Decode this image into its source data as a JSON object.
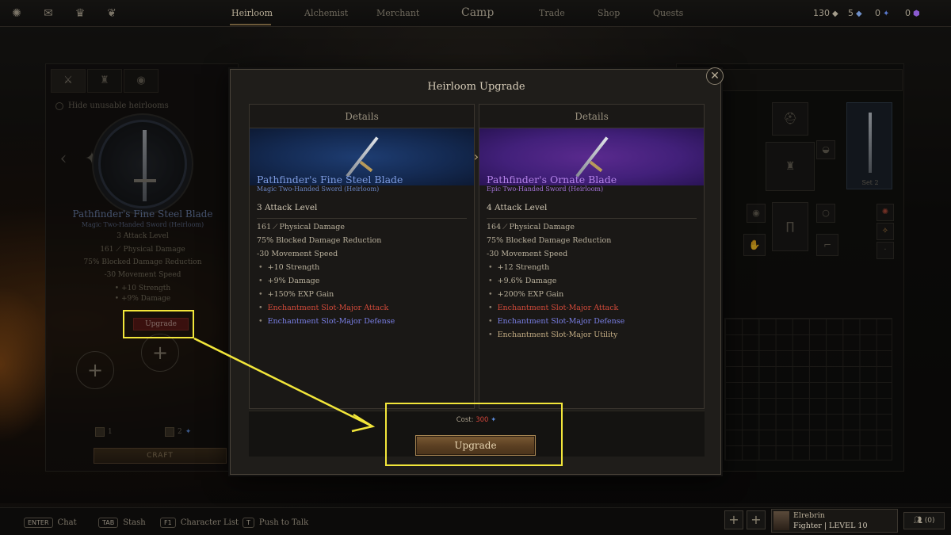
{
  "top_nav": {
    "icons": [
      "compass-icon",
      "mail-icon",
      "trophy-icon",
      "pet-icon"
    ],
    "tabs": [
      {
        "label": "Heirloom",
        "active": true
      },
      {
        "label": "Alchemist",
        "active": false
      },
      {
        "label": "Merchant",
        "active": false
      },
      {
        "label": "Camp",
        "active": false
      },
      {
        "label": "Trade",
        "active": false
      },
      {
        "label": "Shop",
        "active": false
      },
      {
        "label": "Quests",
        "active": false
      }
    ],
    "resources": [
      {
        "value": "130",
        "icon": "gold-icon"
      },
      {
        "value": "5",
        "icon": "crystal-icon"
      },
      {
        "value": "0",
        "icon": "shard-icon"
      },
      {
        "value": "0",
        "icon": "gem-icon"
      }
    ]
  },
  "left_panel": {
    "hide_label": "Hide unusable heirlooms",
    "item_name": "Pathfinder's Fine Steel Blade",
    "item_sub": "Magic Two-Handed Sword (Heirloom)",
    "attack_level": "3 Attack Level",
    "stats": [
      "161 ⟋ Physical Damage",
      "75% Blocked Damage Reduction",
      "-30 Movement Speed",
      "• +10 Strength",
      "• +9% Damage"
    ],
    "upgrade_label": "Upgrade",
    "cost_a": "1",
    "cost_b": "2",
    "craft_label": "CRAFT"
  },
  "right_panel": {
    "set_label": "Set 2"
  },
  "modal": {
    "title": "Heirloom Upgrade",
    "close_glyph": "✕",
    "current": {
      "header": "Details",
      "name": "Pathfinder's Fine Steel Blade",
      "subtitle": "Magic Two-Handed Sword (Heirloom)",
      "attack_level": "3 Attack Level",
      "physical_damage": "161",
      "physical_label": "Physical Damage",
      "base_stats": [
        "75% Blocked Damage Reduction",
        "-30 Movement Speed"
      ],
      "bonuses": [
        "+10 Strength",
        "+9% Damage",
        "+150% EXP Gain"
      ],
      "enchant_attack": "Enchantment Slot-Major Attack",
      "enchant_defense": "Enchantment Slot-Major Defense"
    },
    "upgraded": {
      "header": "Details",
      "name": "Pathfinder's Ornate Blade",
      "subtitle": "Epic Two-Handed Sword (Heirloom)",
      "attack_level": "4 Attack Level",
      "physical_damage": "164",
      "physical_label": "Physical Damage",
      "base_stats": [
        "75% Blocked Damage Reduction",
        "-30 Movement Speed"
      ],
      "bonuses": [
        "+12 Strength",
        "+9.6% Damage",
        "+200% EXP Gain"
      ],
      "enchant_attack": "Enchantment Slot-Major Attack",
      "enchant_defense": "Enchantment Slot-Major Defense",
      "enchant_utility": "Enchantment Slot-Major Utility"
    },
    "cost_label": "Cost:",
    "cost_value": "300",
    "upgrade_label": "Upgrade"
  },
  "bottom_bar": {
    "hints": [
      {
        "key": "ENTER",
        "label": "Chat"
      },
      {
        "key": "TAB",
        "label": "Stash"
      },
      {
        "key": "F1",
        "label": "Character List"
      },
      {
        "key": "T",
        "label": "Push to Talk"
      }
    ],
    "character": {
      "name": "Elrebrin",
      "class_level": "Fighter | LEVEL 10"
    },
    "friends": "(0)"
  },
  "colors": {
    "magic": "#7d9be0",
    "epic": "#b482e8",
    "enchant_attack": "#d24a3a",
    "enchant_defense": "#7a7fe6",
    "enchant_utility": "#c4ad84",
    "highlight": "#f2e63a",
    "cost": "#d2443a"
  }
}
